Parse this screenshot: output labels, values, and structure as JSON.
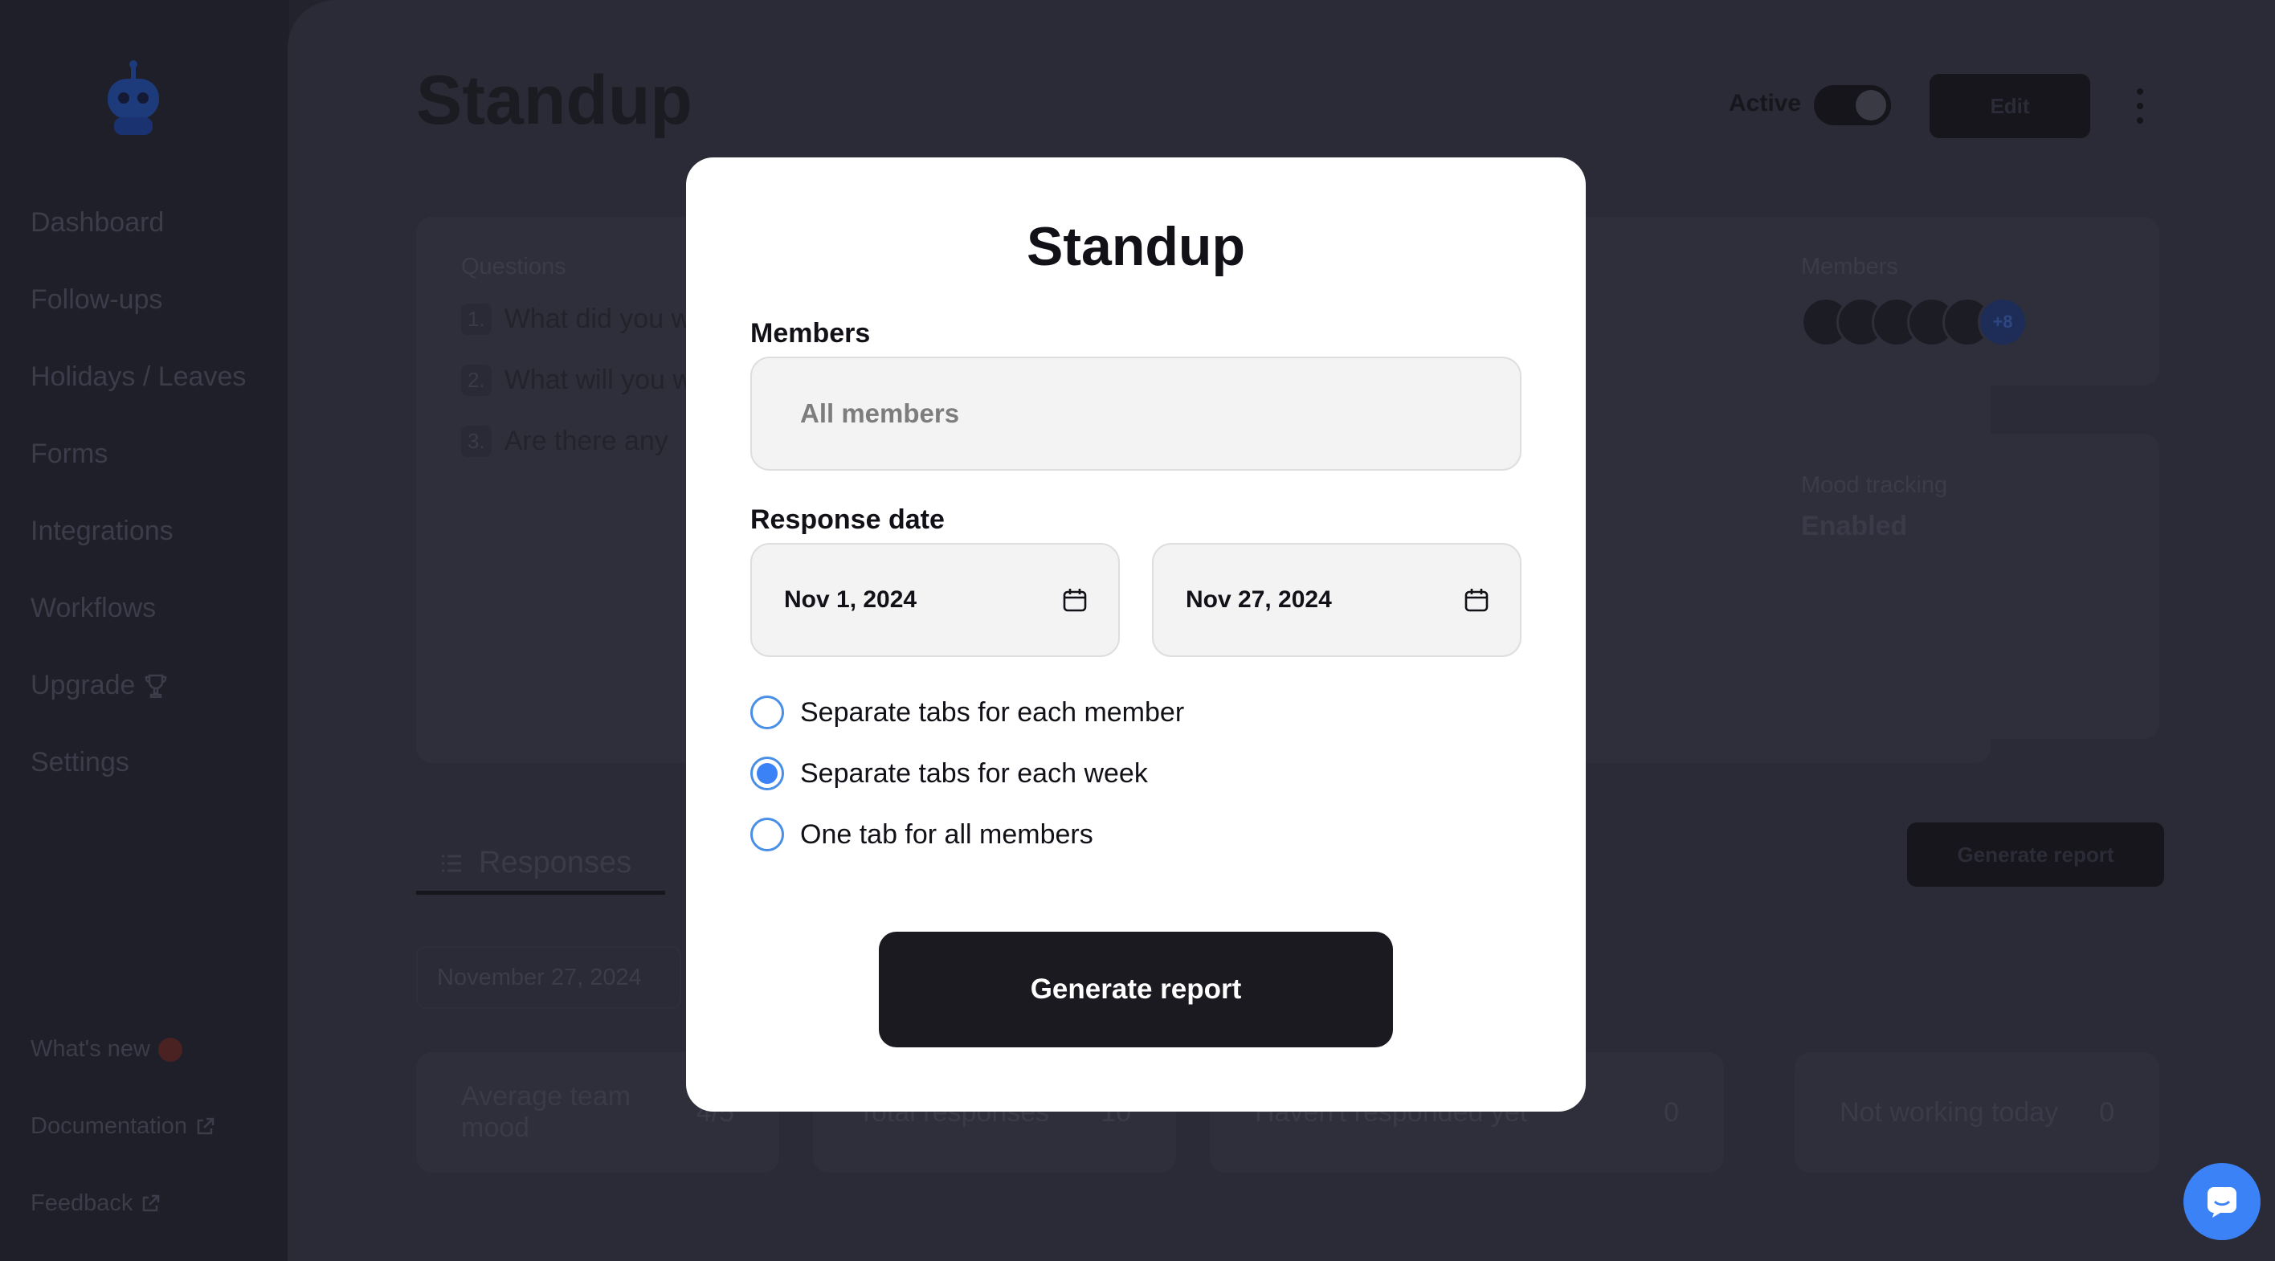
{
  "sidebar": {
    "items": [
      {
        "label": "Dashboard"
      },
      {
        "label": "Follow-ups"
      },
      {
        "label": "Holidays / Leaves"
      },
      {
        "label": "Forms"
      },
      {
        "label": "Integrations"
      },
      {
        "label": "Workflows"
      },
      {
        "label": "Upgrade"
      },
      {
        "label": "Settings"
      }
    ],
    "footer": [
      {
        "label": "What's new"
      },
      {
        "label": "Documentation"
      },
      {
        "label": "Feedback"
      }
    ]
  },
  "header": {
    "title": "Standup",
    "active_label": "Active",
    "active": true,
    "edit_label": "Edit"
  },
  "questions": {
    "label": "Questions",
    "items": [
      {
        "num": "1.",
        "text": "What did you w"
      },
      {
        "num": "2.",
        "text": "What will you w"
      },
      {
        "num": "3.",
        "text": "Are there any"
      }
    ]
  },
  "members_card": {
    "label": "Members",
    "more": "+8"
  },
  "mood_card": {
    "label": "Mood tracking",
    "value": "Enabled"
  },
  "tabs": {
    "responses_label": "Responses"
  },
  "background_generate_label": "Generate report",
  "date_chip": "November 27, 2024",
  "stats": [
    {
      "label": "Average team mood",
      "value": "4/5"
    },
    {
      "label": "Total responses",
      "value": "10"
    },
    {
      "label": "Haven't responded yet",
      "value": "0"
    },
    {
      "label": "Not working today",
      "value": "0"
    }
  ],
  "modal": {
    "title": "Standup",
    "members_label": "Members",
    "members_value": "All members",
    "response_date_label": "Response date",
    "start_date": "Nov 1, 2024",
    "end_date": "Nov 27, 2024",
    "options": [
      {
        "label": "Separate tabs for each member",
        "selected": false
      },
      {
        "label": "Separate tabs for each week",
        "selected": true
      },
      {
        "label": "One tab for all members",
        "selected": false
      }
    ],
    "submit_label": "Generate report"
  },
  "colors": {
    "accent": "#3b82f6",
    "primary_button": "#1b1a21"
  }
}
